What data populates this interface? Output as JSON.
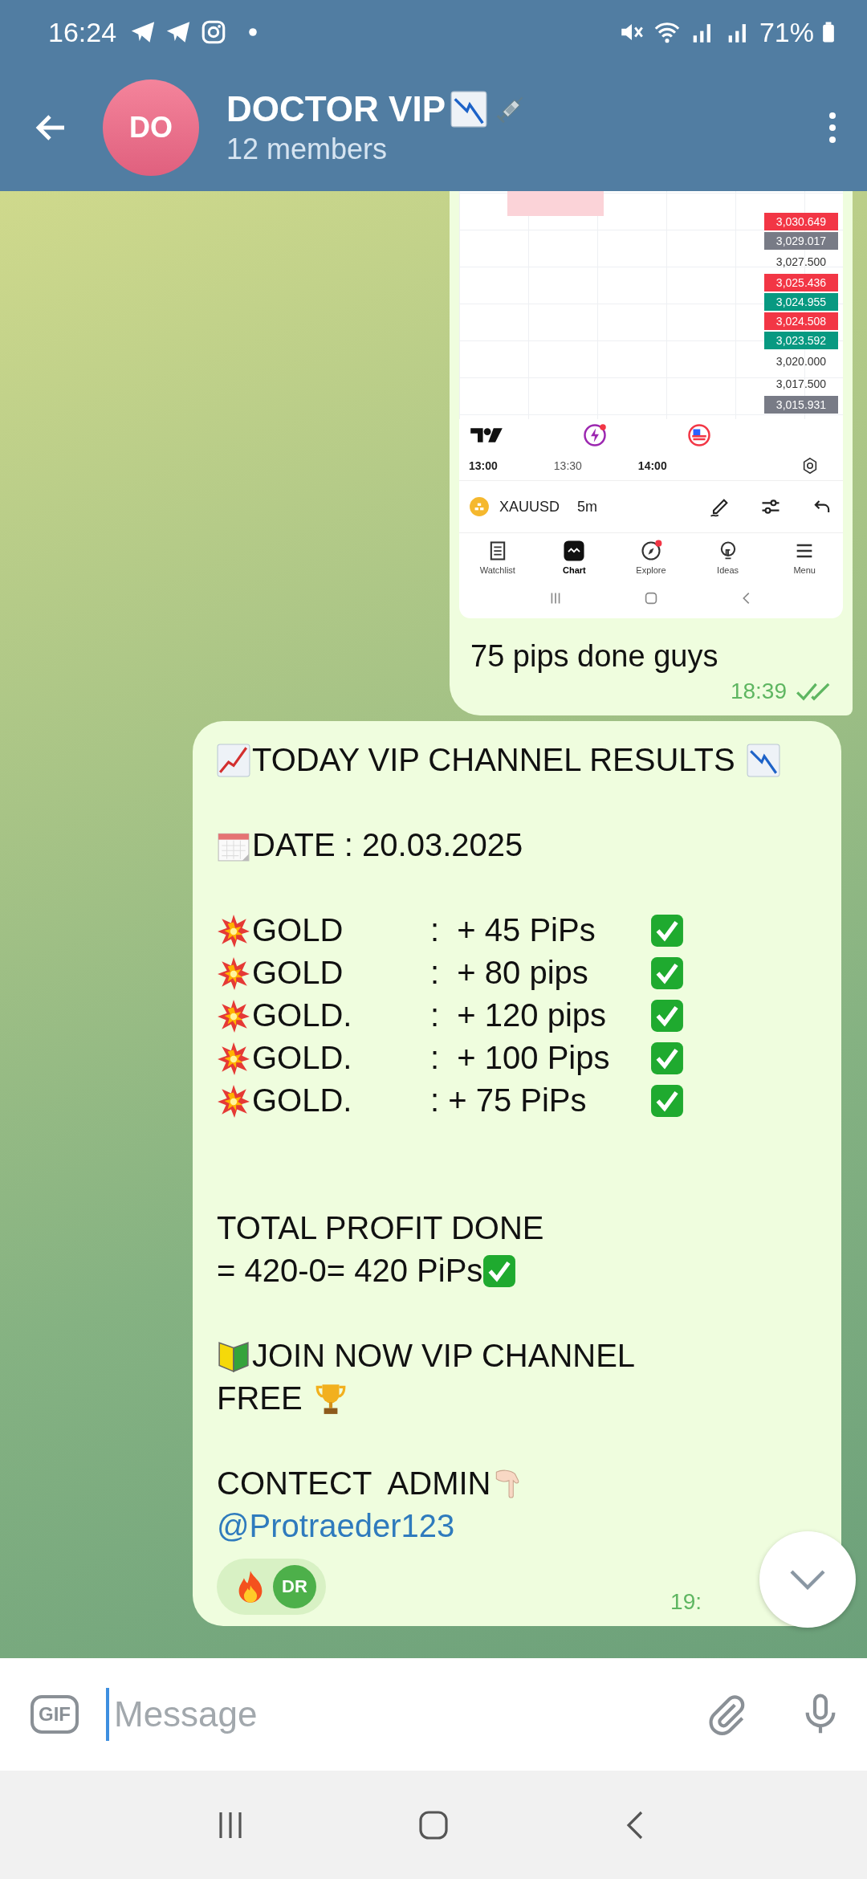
{
  "status_bar": {
    "time": "16:24",
    "battery": "71%"
  },
  "header": {
    "avatar": "DO",
    "title": "DOCTOR VIP",
    "subtitle": "12 members"
  },
  "messages": [
    {
      "kind": "screenshot",
      "screenshot": {
        "price_tags": [
          {
            "kind": "tag",
            "label": "3,030.649",
            "color": "#f23645"
          },
          {
            "kind": "tag",
            "label": "3,029.017",
            "color": "#787b86"
          },
          {
            "kind": "plain",
            "label": "3,027.500"
          },
          {
            "kind": "tag",
            "label": "3,025.436",
            "color": "#f23645"
          },
          {
            "kind": "tag",
            "label": "3,024.955",
            "color": "#089981"
          },
          {
            "kind": "tag",
            "label": "3,024.508",
            "color": "#f23645"
          },
          {
            "kind": "tag",
            "label": "3,023.592",
            "color": "#089981"
          },
          {
            "kind": "plain",
            "label": "3,020.000"
          },
          {
            "kind": "plain",
            "label": "3,017.500"
          },
          {
            "kind": "tag",
            "label": "3,015.931",
            "color": "#787b86"
          }
        ],
        "time_axis": [
          {
            "label": "13:00",
            "bold": true
          },
          {
            "label": "13:30",
            "bold": false
          },
          {
            "label": "14:00",
            "bold": true
          }
        ],
        "symbol": "XAUUSD",
        "interval": "5m",
        "tabs": [
          {
            "kind": "list",
            "label": "Watchlist",
            "selected": false,
            "badge": false
          },
          {
            "kind": "chart",
            "label": "Chart",
            "selected": true,
            "badge": false
          },
          {
            "kind": "compass",
            "label": "Explore",
            "selected": false,
            "badge": true
          },
          {
            "kind": "bulb",
            "label": "Ideas",
            "selected": false,
            "badge": false
          },
          {
            "kind": "menu",
            "label": "Menu",
            "selected": false,
            "badge": false
          }
        ]
      },
      "text": "75 pips done guys",
      "time": "18:39",
      "read": true
    },
    {
      "kind": "post",
      "blocks": [
        {
          "kind": "headline",
          "text": "TODAY VIP CHANNEL RESULTS"
        },
        {
          "kind": "date",
          "text": "DATE : 20.03.2025"
        },
        {
          "kind": "result",
          "asset": "GOLD",
          "value": ":  + 45 PiPs"
        },
        {
          "kind": "result",
          "asset": "GOLD",
          "value": ":  + 80 pips"
        },
        {
          "kind": "result",
          "asset": "GOLD.",
          "value": ":  + 120 pips"
        },
        {
          "kind": "result",
          "asset": "GOLD.",
          "value": ":  + 100 Pips"
        },
        {
          "kind": "result",
          "asset": "GOLD.",
          "value": ": + 75 PiPs"
        },
        {
          "kind": "total",
          "lines": [
            "TOTAL PROFIT DONE",
            "= 420-0= 420 PiPs"
          ]
        },
        {
          "kind": "join",
          "lines": [
            "JOIN NOW VIP CHANNEL",
            "FREE"
          ]
        },
        {
          "kind": "contact",
          "text": "CONTECT  ADMIN"
        },
        {
          "kind": "link",
          "text": "@Protraeder123"
        }
      ],
      "reaction": {
        "avatar": "DR"
      },
      "time": "19:"
    }
  ],
  "composer": {
    "gif": "GIF",
    "placeholder": "Message"
  }
}
